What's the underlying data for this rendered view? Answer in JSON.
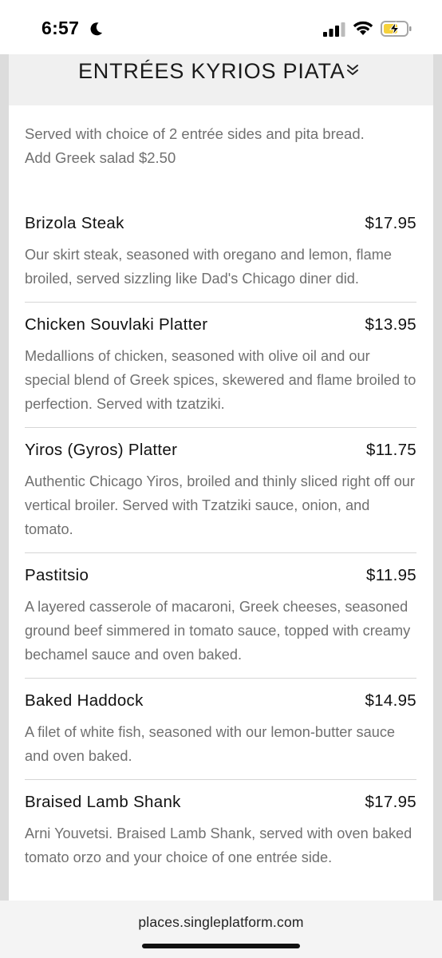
{
  "status_bar": {
    "time": "6:57",
    "icons": [
      "moon-icon",
      "cellular-signal-icon",
      "wifi-icon",
      "battery-charging-icon"
    ],
    "battery_color": "#f5d13c"
  },
  "section": {
    "title": "ENTRÉES KYRIOS PIATA",
    "note_line1": "Served with choice of 2 entrée sides and pita bread.",
    "note_line2": "Add Greek salad $2.50"
  },
  "items": [
    {
      "name": "Brizola Steak",
      "price": "$17.95",
      "desc": "Our skirt steak, seasoned with oregano and lemon, flame broiled, served sizzling like Dad's Chicago diner did."
    },
    {
      "name": "Chicken Souvlaki Platter",
      "price": "$13.95",
      "desc": "Medallions of chicken, seasoned with olive oil and our special blend of Greek spices, skewered and flame broiled to perfection. Served with tzatziki."
    },
    {
      "name": "Yiros (Gyros) Platter",
      "price": "$11.75",
      "desc": "Authentic Chicago Yiros, broiled and thinly sliced right off our vertical broiler. Served with Tzatziki sauce, onion, and tomato."
    },
    {
      "name": "Pastitsio",
      "price": "$11.95",
      "desc": "A layered casserole of macaroni, Greek cheeses, seasoned ground beef simmered in tomato sauce, topped with creamy bechamel sauce and oven baked."
    },
    {
      "name": "Baked Haddock",
      "price": "$14.95",
      "desc": "A filet of white fish, seasoned with our lemon-butter sauce and oven baked."
    },
    {
      "name": "Braised Lamb Shank",
      "price": "$17.95",
      "desc": "Arni Youvetsi. Braised Lamb Shank, served with oven baked tomato orzo and your choice of one entrée side."
    }
  ],
  "browser": {
    "url": "places.singleplatform.com"
  }
}
